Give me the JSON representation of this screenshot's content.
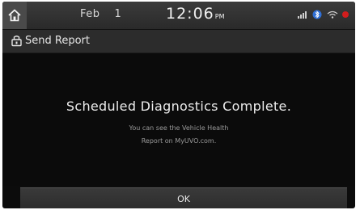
{
  "status_bar": {
    "month": "Feb",
    "day": "1",
    "time": "12:06",
    "ampm": "PM",
    "icons": [
      "home-icon",
      "signal-icon",
      "bluetooth-icon",
      "wifi-icon",
      "recording-icon"
    ],
    "accent_color": "#d21d1d"
  },
  "title_bar": {
    "icon": "send-report-icon",
    "label": "Send Report"
  },
  "dialog": {
    "headline": "Scheduled Diagnostics Complete.",
    "message_line1": "You can see the Vehicle Health",
    "message_line2": "Report on MyUVO.com."
  },
  "actions": {
    "ok_label": "OK"
  }
}
